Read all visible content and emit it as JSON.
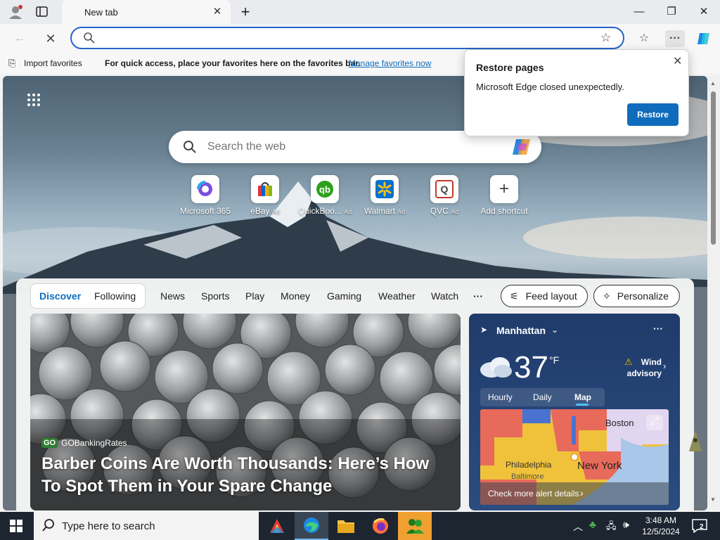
{
  "browser": {
    "tab_title": "New tab",
    "address_value": "",
    "favorites_bar": {
      "import_label": "Import favorites",
      "message": "For quick access, place your favorites here on the favorites bar.",
      "manage_link": "Manage favorites now"
    }
  },
  "restore_popup": {
    "title": "Restore pages",
    "message": "Microsoft Edge closed unexpectedly.",
    "button": "Restore"
  },
  "newtab": {
    "search_placeholder": "Search the web",
    "shortcuts": [
      {
        "label": "Microsoft 365",
        "ad": "",
        "icon": "microsoft365-icon"
      },
      {
        "label": "eBay",
        "ad": "Ad",
        "icon": "ebay-icon"
      },
      {
        "label": "QuickBoo...",
        "ad": "Ad",
        "icon": "quickbooks-icon"
      },
      {
        "label": "Walmart",
        "ad": "Ad",
        "icon": "walmart-icon"
      },
      {
        "label": "QVC",
        "ad": "Ad",
        "icon": "qvc-icon"
      },
      {
        "label": "Add shortcut",
        "ad": "",
        "icon": "plus-icon"
      }
    ]
  },
  "feed": {
    "tabs": [
      "Discover",
      "Following"
    ],
    "nav": [
      "News",
      "Sports",
      "Play",
      "Money",
      "Gaming",
      "Weather",
      "Watch"
    ],
    "more": "···",
    "feed_layout": "Feed layout",
    "personalize": "Personalize"
  },
  "article": {
    "source": "GOBankingRates",
    "source_logo": "GO",
    "headline": "Barber Coins Are Worth Thousands: Here’s How To Spot Them in Your Spare Change"
  },
  "weather": {
    "location": "Manhattan",
    "temperature": "37",
    "unit": "°F",
    "alert": "Wind advisory",
    "tabs": [
      "Hourly",
      "Daily",
      "Map"
    ],
    "map_labels": [
      "Boston",
      "Philadelphia",
      "New York",
      "Baltimore"
    ],
    "alert_link": "Check more alert details"
  },
  "taskbar": {
    "search_placeholder": "Type here to search",
    "time": "3:48 AM",
    "date": "12/5/2024",
    "notifications": "2"
  },
  "colors": {
    "accent": "#0f6cbd",
    "address_border": "#2563c9",
    "taskbar": "#1c2530"
  }
}
